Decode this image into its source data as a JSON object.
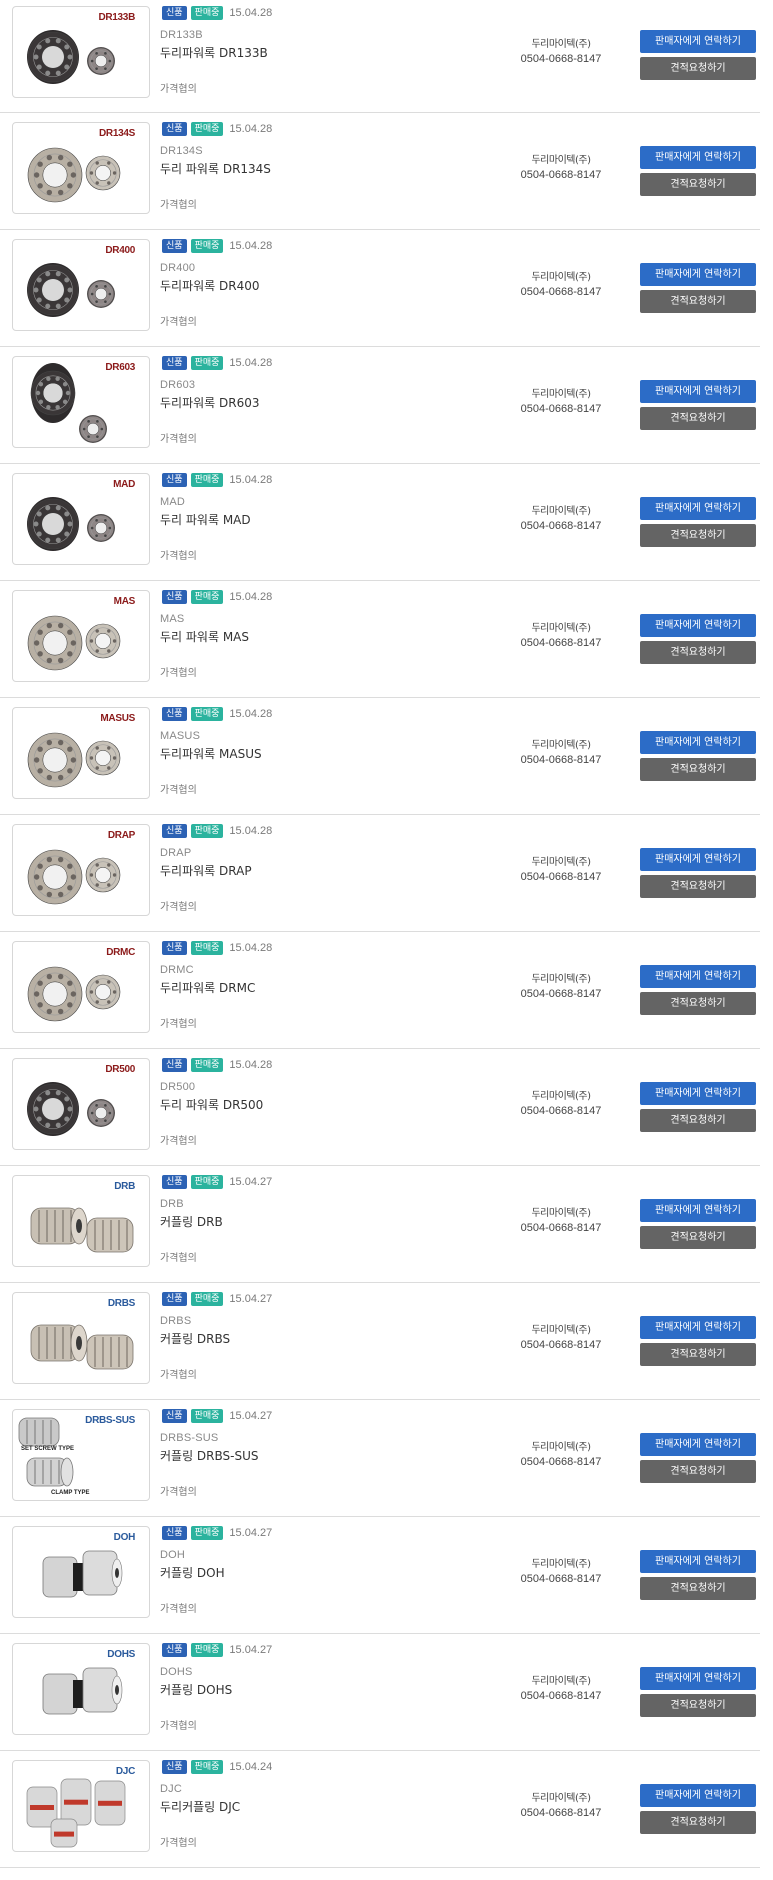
{
  "common": {
    "badge_new": "신품",
    "badge_sale": "판매중",
    "seller": "두리마이텍(주)",
    "phone": "0504-0668-8147",
    "price": "가격협의",
    "contact_label": "판매자에게 연락하기",
    "quote_label": "견적요청하기",
    "colors": {
      "badge_new": "#2c62b4",
      "badge_sale": "#2bb39e",
      "contact_button": "#2c6cc7",
      "quote_button": "#646464",
      "label_red": "#8b1a1a",
      "label_blue": "#2a5a9c"
    }
  },
  "products": [
    {
      "thumb_label": "DR133B",
      "label_color": "red",
      "image": "dark-locking-assembly",
      "date": "15.04.28",
      "model": "DR133B",
      "name": "두리파워록 DR133B"
    },
    {
      "thumb_label": "DR134S",
      "label_color": "red",
      "image": "silver-locking-assembly",
      "date": "15.04.28",
      "model": "DR134S",
      "name": "두리 파워록 DR134S"
    },
    {
      "thumb_label": "DR400",
      "label_color": "red",
      "image": "dark-locking-assembly",
      "date": "15.04.28",
      "model": "DR400",
      "name": "두리파워록 DR400"
    },
    {
      "thumb_label": "DR603",
      "label_color": "red",
      "image": "dark-tall-locking-assembly",
      "date": "15.04.28",
      "model": "DR603",
      "name": "두리파워록 DR603"
    },
    {
      "thumb_label": "MAD",
      "label_color": "red",
      "image": "dark-locking-assembly",
      "date": "15.04.28",
      "model": "MAD",
      "name": "두리 파워록 MAD"
    },
    {
      "thumb_label": "MAS",
      "label_color": "red",
      "image": "silver-locking-assembly",
      "date": "15.04.28",
      "model": "MAS",
      "name": "두리 파워록 MAS"
    },
    {
      "thumb_label": "MASUS",
      "label_color": "red",
      "image": "silver-locking-assembly",
      "date": "15.04.28",
      "model": "MASUS",
      "name": "두리파워록 MASUS"
    },
    {
      "thumb_label": "DRAP",
      "label_color": "red",
      "image": "silver-locking-assembly",
      "date": "15.04.28",
      "model": "DRAP",
      "name": "두리파워록 DRAP"
    },
    {
      "thumb_label": "DRMC",
      "label_color": "red",
      "image": "silver-locking-assembly",
      "date": "15.04.28",
      "model": "DRMC",
      "name": "두리파워록 DRMC"
    },
    {
      "thumb_label": "DR500",
      "label_color": "red",
      "image": "dark-locking-assembly",
      "date": "15.04.28",
      "model": "DR500",
      "name": "두리 파워록 DR500"
    },
    {
      "thumb_label": "DRB",
      "label_color": "blue",
      "image": "slit-coupling",
      "date": "15.04.27",
      "model": "DRB",
      "name": "커플링 DRB"
    },
    {
      "thumb_label": "DRBS",
      "label_color": "blue",
      "image": "slit-coupling",
      "date": "15.04.27",
      "model": "DRBS",
      "name": "커플링 DRBS"
    },
    {
      "thumb_label": "DRBS-SUS",
      "label_color": "blue",
      "image": "set-screw-clamp-coupling",
      "date": "15.04.27",
      "model": "DRBS-SUS",
      "name": "커플링 DRBS-SUS",
      "extra_labels": [
        "SET SCREW TYPE",
        "CLAMP TYPE"
      ]
    },
    {
      "thumb_label": "DOH",
      "label_color": "blue",
      "image": "jaw-coupling",
      "date": "15.04.27",
      "model": "DOH",
      "name": "커플링 DOH"
    },
    {
      "thumb_label": "DOHS",
      "label_color": "blue",
      "image": "jaw-coupling",
      "date": "15.04.27",
      "model": "DOHS",
      "name": "커플링 DOHS"
    },
    {
      "thumb_label": "DJC",
      "label_color": "blue",
      "image": "red-jaw-coupling",
      "date": "15.04.24",
      "model": "DJC",
      "name": "두리커플링 DJC"
    }
  ]
}
